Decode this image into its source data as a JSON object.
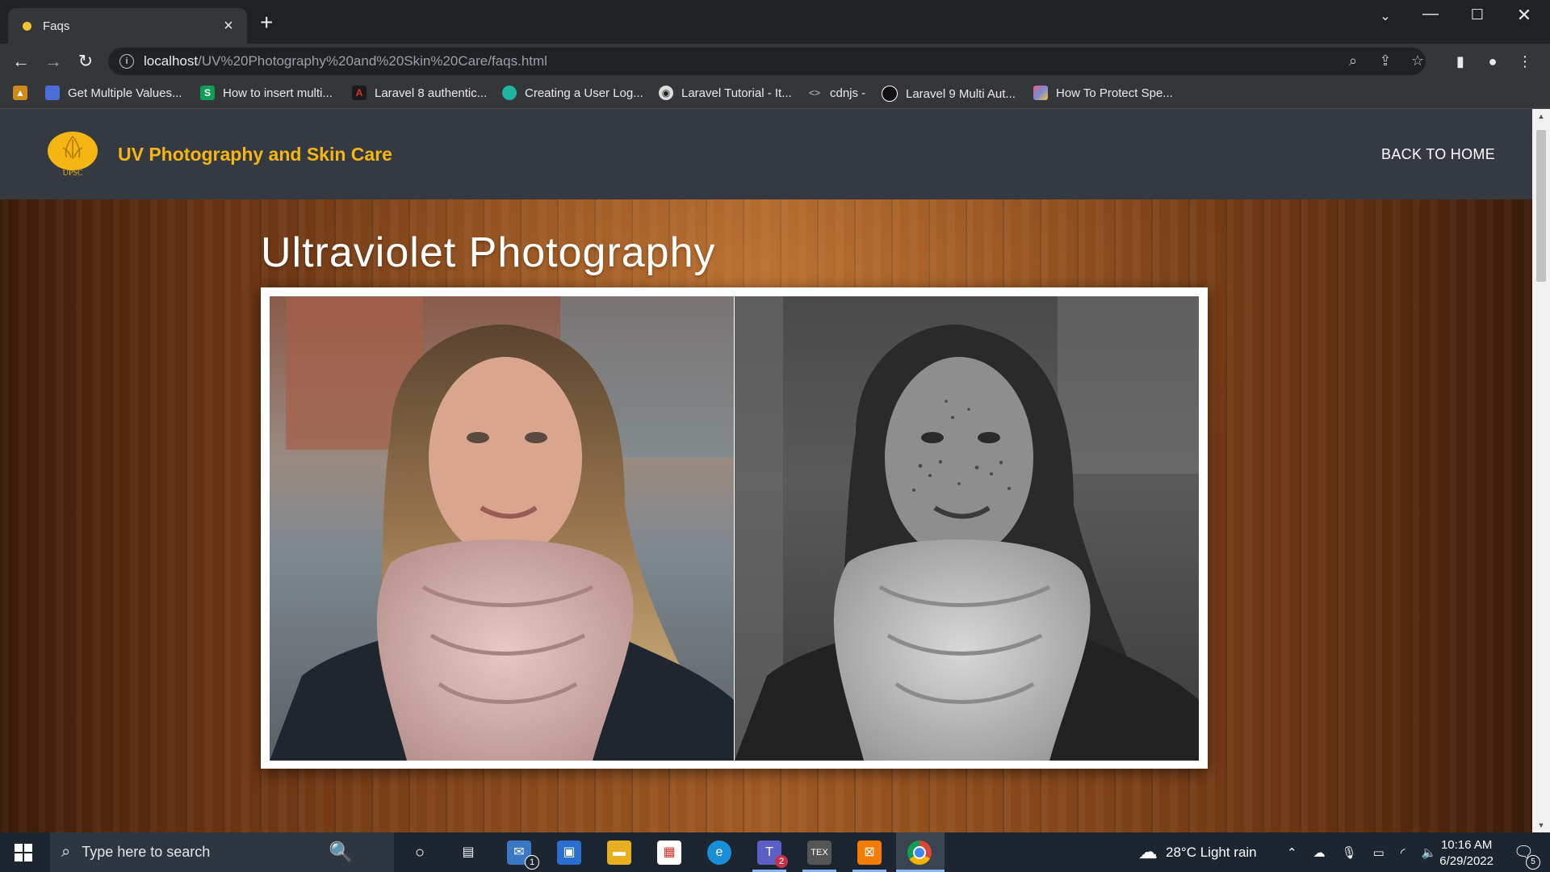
{
  "browser": {
    "tab_title": "Faqs",
    "tab_close": "×",
    "new_tab": "+",
    "url_host": "localhost",
    "url_path": "/UV%20Photography%20and%20Skin%20Care/faqs.html",
    "bookmarks": [
      {
        "label": "Get Multiple Values...",
        "color": "#4a6cd4"
      },
      {
        "label": "How to insert multi...",
        "color": "#0f9d58"
      },
      {
        "label": "Laravel 8 authentic...",
        "color": "#e0312b"
      },
      {
        "label": "Creating a User Log...",
        "color": "#1fb5a3"
      },
      {
        "label": "Laravel Tutorial - It...",
        "color": "#dddddd"
      },
      {
        "label": "cdnjs -",
        "color": "#9aa0a6"
      },
      {
        "label": "Laravel 9 Multi Aut...",
        "color": "#111111"
      },
      {
        "label": "How To Protect Spe...",
        "color": "#7a8cd4"
      }
    ]
  },
  "site": {
    "brand": "UV Photography and Skin Care",
    "logo_text": "UPSC",
    "nav_back_home": "BACK TO HOME",
    "page_title": "Ultraviolet Photography",
    "accent_color": "#f5b613",
    "header_color": "#353a42"
  },
  "taskbar": {
    "search_placeholder": "Type here to search",
    "weather": "28°C  Light rain",
    "time": "10:16 AM",
    "date": "6/29/2022",
    "mail_badge": "1",
    "teams_badge": "2",
    "notification_count": "5"
  }
}
